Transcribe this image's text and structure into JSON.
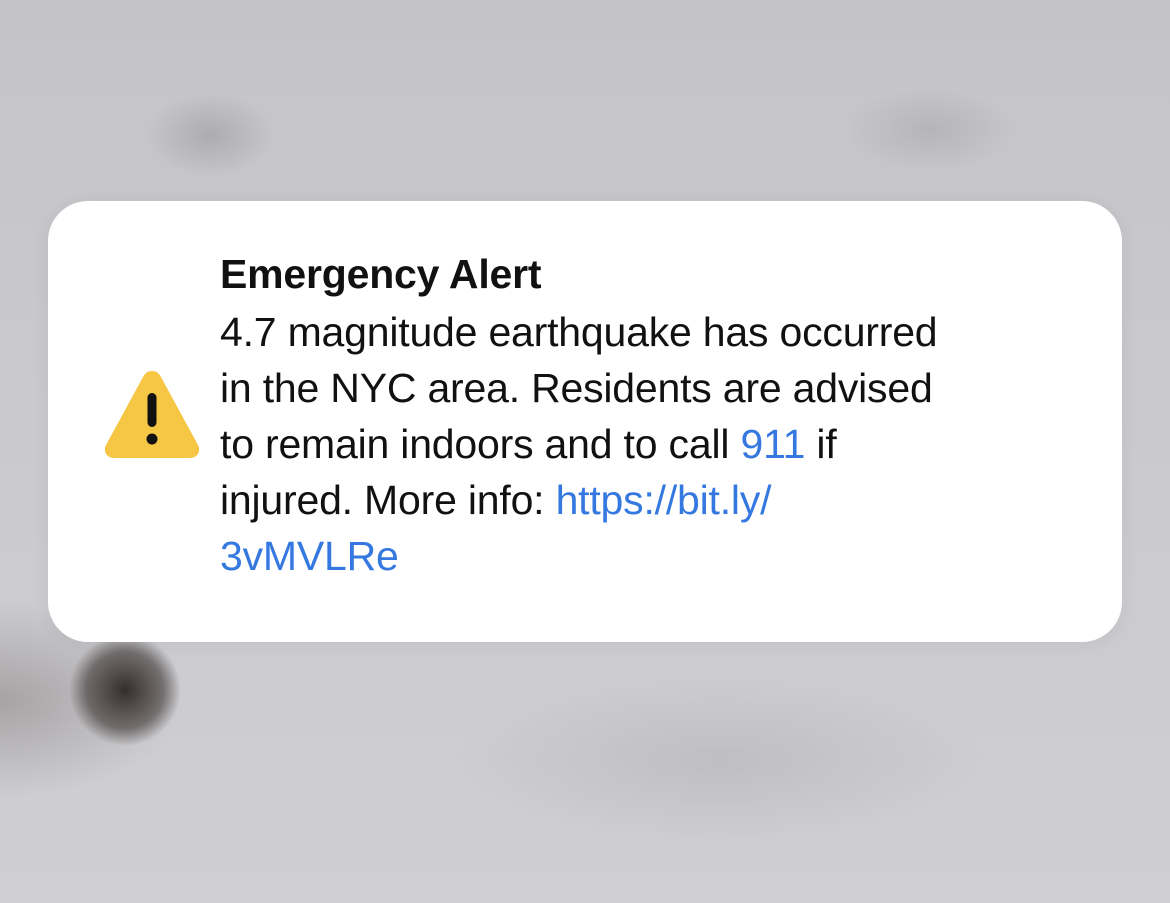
{
  "alert": {
    "icon": "warning-triangle-icon",
    "icon_color": "#f5c744",
    "link_color": "#3478e0",
    "title": "Emergency Alert",
    "body_line_1": "4.7 magnitude earthquake has occurred",
    "body_line_2": "in the NYC area. Residents are advised",
    "body_line_3_pre": "to remain indoors and to call ",
    "phone": "911",
    "body_line_3_post": " if",
    "body_line_4_pre": "injured. More info: ",
    "link_part_1": "https://bit.ly/",
    "link_part_2": "3vMVLRe"
  }
}
